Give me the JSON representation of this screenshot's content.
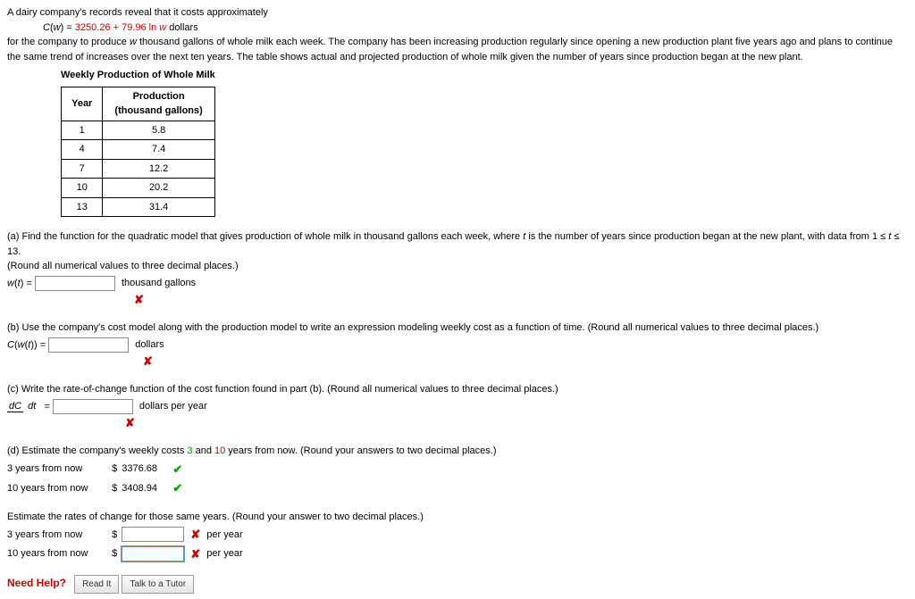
{
  "intro1": "A dairy company's records reveal that it costs approximately",
  "formula_c_left": "C",
  "formula_c_arg": "w",
  "formula_eq": " = ",
  "formula_num1": "3250.26 + 79.96 ln ",
  "formula_w": "w",
  "formula_unit": " dollars",
  "intro2_a": "for the company to produce ",
  "intro2_b": " thousand gallons of whole milk each week. The company has been increasing production regularly since opening a new production plant five years ago and plans to continue the same trend of increases over the next ten years. The table shows actual and projected production of whole milk given the number of years since production began at the new plant.",
  "table": {
    "caption": "Weekly Production of Whole Milk",
    "headers": {
      "year": "Year",
      "prod": "Production\n(thousand gallons)"
    },
    "rows": [
      {
        "year": "1",
        "prod": "5.8"
      },
      {
        "year": "4",
        "prod": "7.4"
      },
      {
        "year": "7",
        "prod": "12.2"
      },
      {
        "year": "10",
        "prod": "20.2"
      },
      {
        "year": "13",
        "prod": "31.4"
      }
    ]
  },
  "partA": {
    "text1": "(a) Find the function for the quadratic model that gives production of whole milk in thousand gallons each week, where ",
    "t": "t",
    "text2": " is the number of years since production began at the new plant, with data from  1 ≤ ",
    "text3": " ≤ 13.",
    "round": "(Round all numerical values to three decimal places.)",
    "lhs1": "w",
    "lhs2": "(",
    "lhs3": "t",
    "lhs4": ") = ",
    "unit": "thousand gallons"
  },
  "partB": {
    "text": "(b) Use the company's cost model along with the production model to write an expression modeling weekly cost as a function of time. (Round all numerical values to three decimal places.)",
    "lhs": "C(w(t)) = ",
    "unit": "dollars"
  },
  "partC": {
    "text": "(c) Write the rate-of-change function of the cost function found in part (b). (Round all numerical values to three decimal places.)",
    "frac_num": "dC",
    "frac_den": "dt",
    "eq": " = ",
    "unit": "dollars per year"
  },
  "partD": {
    "text1": "(d) Estimate the company's weekly costs ",
    "yr3": "3",
    "text2": " and ",
    "yr10": "10",
    "text3": " years from now. (Round your answers to two decimal places.)",
    "row3_label": "3 years from now",
    "row10_label": "10 years from now",
    "dollar": "$",
    "ans3": "3376.68",
    "ans10": "3408.94",
    "rates_text": "Estimate the rates of change for those same years. (Round your answer to two decimal places.)",
    "rate_unit": "per year"
  },
  "help": {
    "need": "Need Help?",
    "read": "Read It",
    "tutor": "Talk to a Tutor"
  }
}
